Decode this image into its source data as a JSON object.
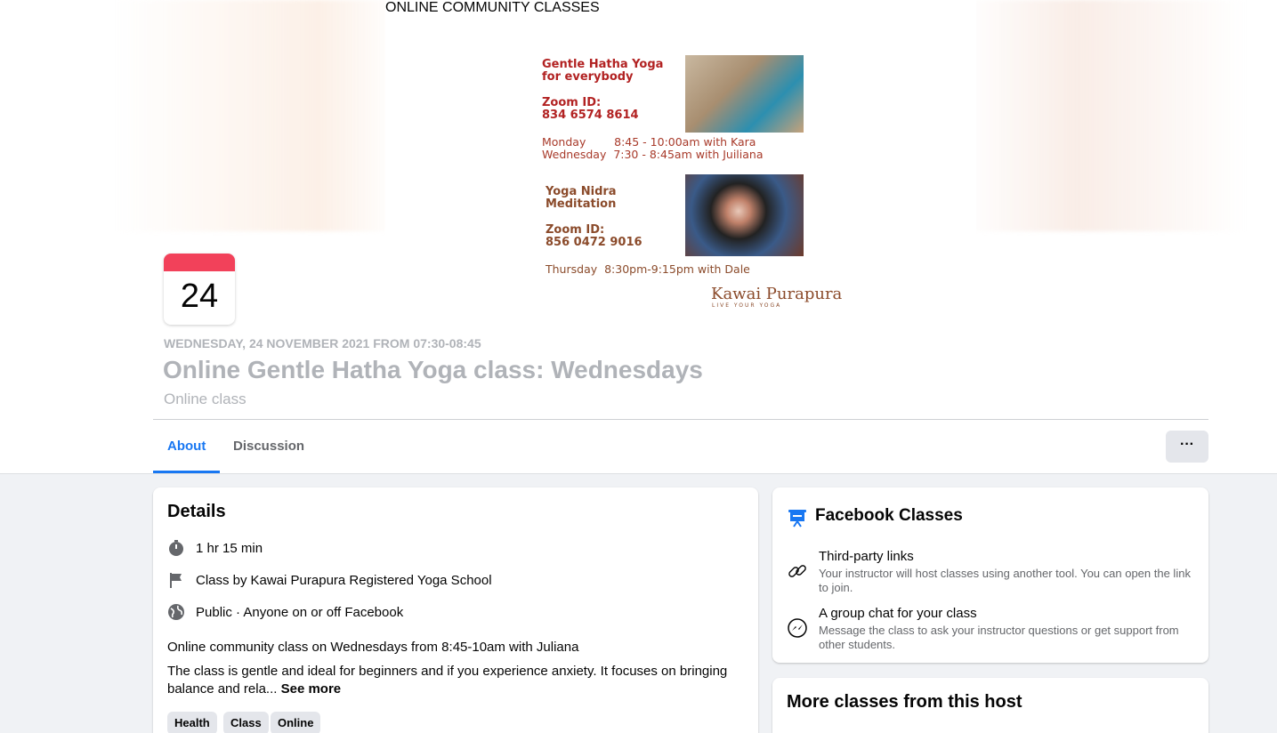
{
  "poster": {
    "heading": "ONLINE COMMUNITY CLASSES",
    "hatha_line1": "Gentle Hatha Yoga",
    "hatha_line2": "for everybody",
    "zoom1_label": "Zoom ID:",
    "zoom1_id": "834 6574 8614",
    "sched1": "Monday        8:45 - 10:00am with Kara",
    "sched2": "Wednesday  7:30 - 8:45am with Juiliana",
    "nidra_line1": "Yoga Nidra",
    "nidra_line2": "Meditation",
    "zoom2_label": "Zoom ID:",
    "zoom2_id": "856 0472 9016",
    "sched3": "Thursday  8:30pm-9:15pm with Dale",
    "logo": "Kawai Purapura",
    "logo_sub": "LIVE YOUR YOGA"
  },
  "calendar": {
    "day": "24",
    "accent": "#f2415a"
  },
  "event": {
    "date_line": "WEDNESDAY, 24 NOVEMBER 2021 FROM 07:30-08:45",
    "title": "Online Gentle Hatha Yoga class: Wednesdays",
    "subtitle": "Online class"
  },
  "tabs": [
    {
      "label": "About",
      "active": true
    },
    {
      "label": "Discussion",
      "active": false
    }
  ],
  "more_button": "···",
  "details": {
    "title": "Details",
    "duration": "1 hr 15 min",
    "class_by_prefix": "Class by",
    "class_by_host": "Kawai Purapura Registered Yoga School",
    "privacy": "Public · Anyone on or off Facebook",
    "desc1": "Online community class on Wednesdays from 8:45-10am with Juliana",
    "desc2_a": "The class is gentle and ideal for beginners and if you experience anxiety. It focuses on bringing",
    "desc2_b": "balance and rela...",
    "see_more": "See more",
    "tags": [
      "Health",
      "Class",
      "Online"
    ]
  },
  "fb_classes": {
    "title": "Facebook Classes",
    "row1_title": "Third-party links",
    "row1_text": "Your instructor will host classes using another tool. You can open the link to join.",
    "row2_title": "A group chat for your class",
    "row2_text": "Message the class to ask your instructor questions or get support from other students.",
    "accent": "#1877f2"
  },
  "more_classes": {
    "title": "More classes from this host"
  }
}
